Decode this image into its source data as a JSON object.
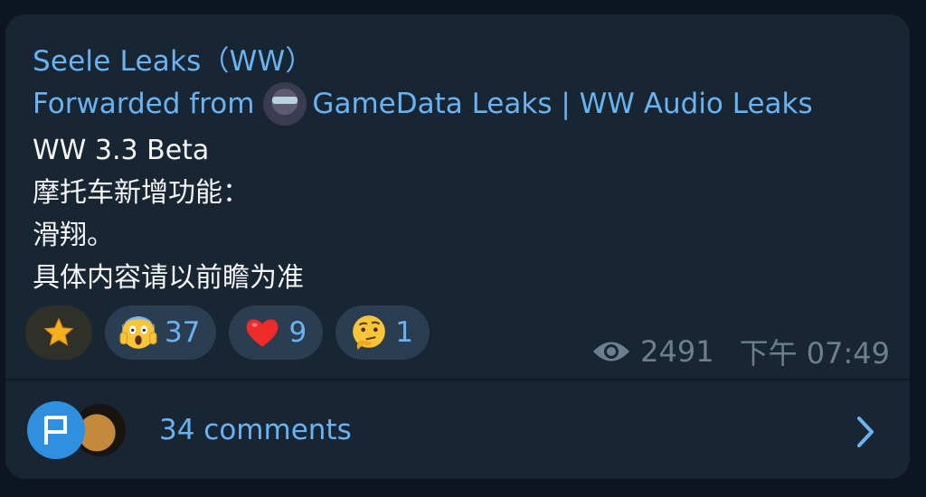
{
  "post": {
    "channel_name": "Seele Leaks（WW）",
    "forwarded_prefix": "Forwarded from",
    "forwarded_source": "GameData Leaks | WW Audio Leaks",
    "lines": [
      "WW 3.3 Beta",
      "摩托车新增功能：",
      "滑翔。",
      "具体内容请以前瞻为准"
    ]
  },
  "reactions": [
    {
      "icon": "star-icon",
      "count": ""
    },
    {
      "icon": "scream-face-icon",
      "count": "37"
    },
    {
      "icon": "red-heart-icon",
      "count": "9"
    },
    {
      "icon": "thinking-face-icon",
      "count": "1"
    }
  ],
  "meta": {
    "views": "2491",
    "time": "下午 07:49"
  },
  "comments": {
    "label": "34 comments"
  },
  "colors": {
    "accent": "#6ab3f3",
    "card_bg": "#182533",
    "page_bg": "#0d1520",
    "muted": "#6d7f8f"
  }
}
